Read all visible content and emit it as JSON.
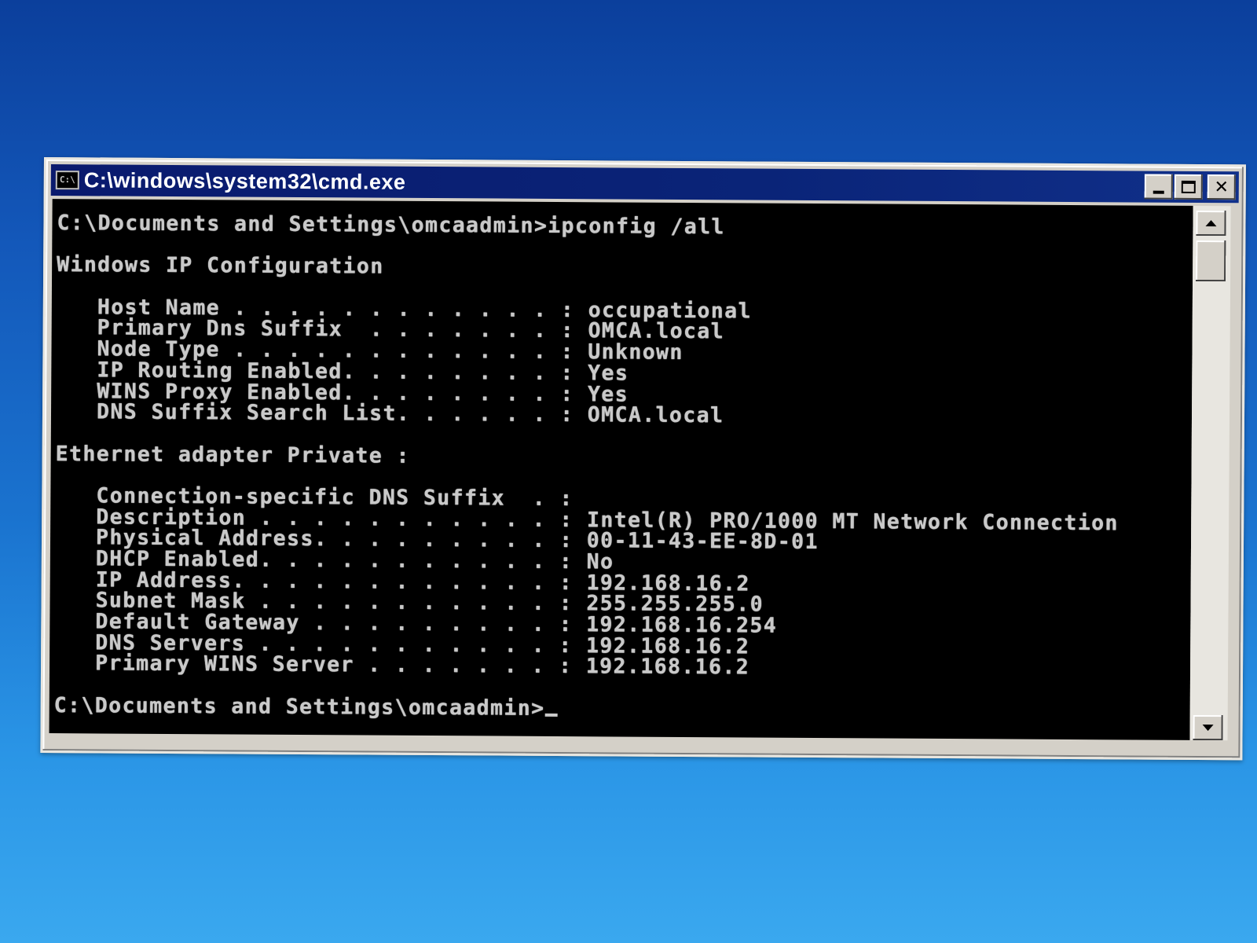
{
  "window": {
    "icon_text": "C:\\",
    "title": "C:\\windows\\system32\\cmd.exe"
  },
  "console": {
    "command_line": "C:\\Documents and Settings\\omcaadmin>ipconfig /all",
    "section_title": "Windows IP Configuration",
    "ip_config": [
      {
        "label": "   Host Name . . . . . . . . . . . . : ",
        "value": "occupational"
      },
      {
        "label": "   Primary Dns Suffix  . . . . . . . : ",
        "value": "OMCA.local"
      },
      {
        "label": "   Node Type . . . . . . . . . . . . : ",
        "value": "Unknown"
      },
      {
        "label": "   IP Routing Enabled. . . . . . . . : ",
        "value": "Yes"
      },
      {
        "label": "   WINS Proxy Enabled. . . . . . . . : ",
        "value": "Yes"
      },
      {
        "label": "   DNS Suffix Search List. . . . . . : ",
        "value": "OMCA.local"
      }
    ],
    "adapter_title": "Ethernet adapter Private :",
    "adapter": [
      {
        "label": "   Connection-specific DNS Suffix  . : ",
        "value": ""
      },
      {
        "label": "   Description . . . . . . . . . . . : ",
        "value": "Intel(R) PRO/1000 MT Network Connection"
      },
      {
        "label": "   Physical Address. . . . . . . . . : ",
        "value": "00-11-43-EE-8D-01"
      },
      {
        "label": "   DHCP Enabled. . . . . . . . . . . : ",
        "value": "No"
      },
      {
        "label": "   IP Address. . . . . . . . . . . . : ",
        "value": "192.168.16.2"
      },
      {
        "label": "   Subnet Mask . . . . . . . . . . . : ",
        "value": "255.255.255.0"
      },
      {
        "label": "   Default Gateway . . . . . . . . . : ",
        "value": "192.168.16.254"
      },
      {
        "label": "   DNS Servers . . . . . . . . . . . : ",
        "value": "192.168.16.2"
      },
      {
        "label": "   Primary WINS Server . . . . . . . : ",
        "value": "192.168.16.2"
      }
    ],
    "prompt": "C:\\Documents and Settings\\omcaadmin>"
  }
}
